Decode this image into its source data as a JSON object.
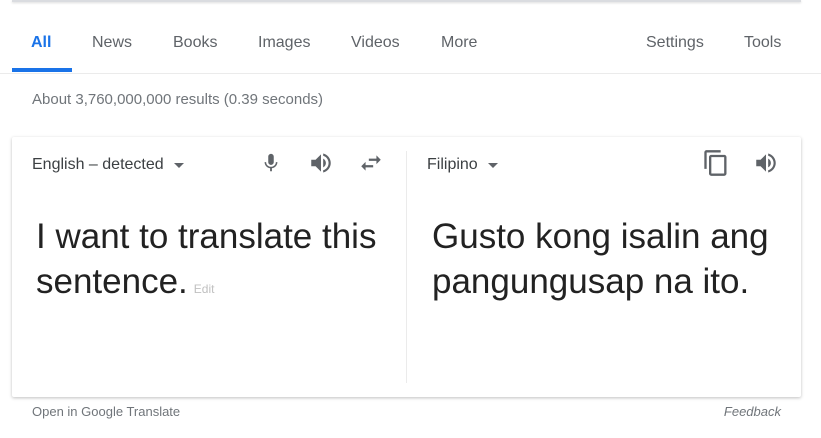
{
  "tabs": [
    {
      "label": "All",
      "active": true
    },
    {
      "label": "News"
    },
    {
      "label": "Books"
    },
    {
      "label": "Images"
    },
    {
      "label": "Videos"
    },
    {
      "label": "More"
    }
  ],
  "tools": {
    "settings_label": "Settings",
    "tools_label": "Tools"
  },
  "result_stats": "About 3,760,000,000 results (0.39 seconds)",
  "translator": {
    "source_lang": "English – detected",
    "target_lang": "Filipino",
    "source_text": "I want to translate this sentence.",
    "edit_label": "Edit",
    "target_text": "Gusto kong isalin ang pangungusap na ito.",
    "icons": [
      "microphone-icon",
      "speaker-icon",
      "swap-icon",
      "copy-icon",
      "speaker-icon"
    ]
  },
  "footer": {
    "open_label": "Open in Google Translate",
    "feedback_label": "Feedback"
  },
  "colors": {
    "accent": "#1a73e8",
    "muted_text": "#70757a",
    "icon": "#5f6368"
  }
}
